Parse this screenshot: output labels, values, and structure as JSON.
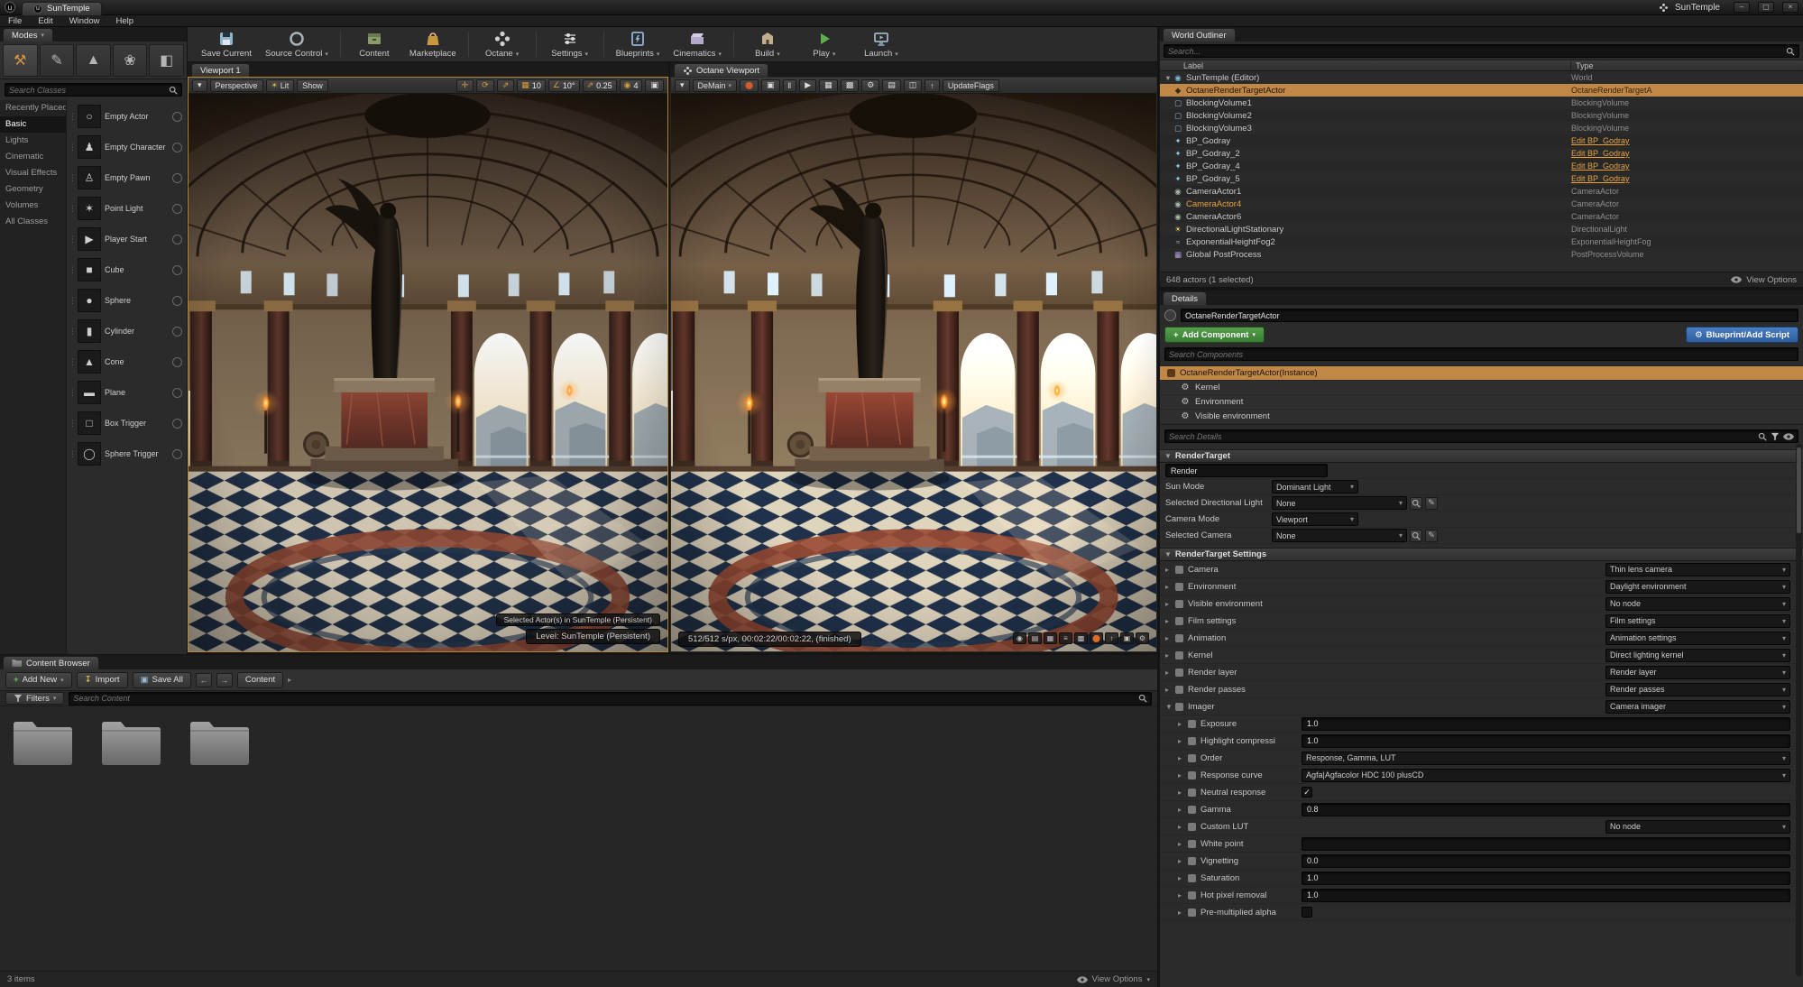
{
  "colors": {
    "selection_tan": "#c08747",
    "accent_orange": "#e8a33d",
    "snap_orange": "#d89a3a",
    "play_green": "#5fae4f",
    "add_component_green": "#4a9342",
    "blueprint_blue": "#3a6cb0",
    "active_viewport_border": "#b5882d"
  },
  "glyphs": {
    "dropdown": "▾",
    "expand_open": "▼",
    "expand_closed": "▸",
    "breadcrumb_sep": "▸",
    "back": "←",
    "forward": "→",
    "close": "×",
    "minimize": "–",
    "restore": "▢",
    "check": "✓",
    "plus": "+",
    "grip": "⋮",
    "sun": "☀",
    "pause": "‖",
    "play": "▶",
    "record": "⬤",
    "camera": "◉",
    "grid": "▦",
    "angle": "∠",
    "scale": "⇗",
    "move": "✛",
    "rotate": "⟳",
    "maximize": "▣",
    "gear": "⚙",
    "pencil": "✎",
    "question": "?",
    "u_logo": "u"
  },
  "titlebar": {
    "doc_tab": "SunTemple",
    "project_title": "SunTemple"
  },
  "menubar": {
    "items": [
      "File",
      "Edit",
      "Window",
      "Help"
    ]
  },
  "modes": {
    "tab": "Modes",
    "search_placeholder": "Search Classes",
    "tools": [
      {
        "name": "place",
        "glyph": "⚒"
      },
      {
        "name": "paint",
        "glyph": "✎"
      },
      {
        "name": "landscape",
        "glyph": "▲"
      },
      {
        "name": "foliage",
        "glyph": "❀"
      },
      {
        "name": "geometry",
        "glyph": "◧"
      }
    ],
    "categories": [
      "Recently Placed",
      "Basic",
      "Lights",
      "Cinematic",
      "Visual Effects",
      "Geometry",
      "Volumes",
      "All Classes"
    ],
    "active_category": "Basic",
    "items": [
      {
        "label": "Empty Actor",
        "glyph": "○"
      },
      {
        "label": "Empty Character",
        "glyph": "♟"
      },
      {
        "label": "Empty Pawn",
        "glyph": "♙"
      },
      {
        "label": "Point Light",
        "glyph": "✶"
      },
      {
        "label": "Player Start",
        "glyph": "▶"
      },
      {
        "label": "Cube",
        "glyph": "■"
      },
      {
        "label": "Sphere",
        "glyph": "●"
      },
      {
        "label": "Cylinder",
        "glyph": "▮"
      },
      {
        "label": "Cone",
        "glyph": "▲"
      },
      {
        "label": "Plane",
        "glyph": "▬"
      },
      {
        "label": "Box Trigger",
        "glyph": "□"
      },
      {
        "label": "Sphere Trigger",
        "glyph": "◯"
      }
    ]
  },
  "main_toolbar": {
    "buttons": [
      {
        "label": "Save Current",
        "dropdown": false
      },
      {
        "label": "Source Control",
        "dropdown": true
      },
      {
        "label": "Content",
        "dropdown": false
      },
      {
        "label": "Marketplace",
        "dropdown": false
      },
      {
        "label": "Octane",
        "dropdown": true
      },
      {
        "label": "Settings",
        "dropdown": true
      },
      {
        "label": "Blueprints",
        "dropdown": true
      },
      {
        "label": "Cinematics",
        "dropdown": true
      },
      {
        "label": "Build",
        "dropdown": true
      },
      {
        "label": "Play",
        "dropdown": true
      },
      {
        "label": "Launch",
        "dropdown": true
      }
    ]
  },
  "viewport1": {
    "tab": "Viewport 1",
    "perspective": "Perspective",
    "lit": "Lit",
    "show": "Show",
    "grid_snap": "10",
    "angle_snap": "10°",
    "scale_snap": "0.25",
    "camera_speed": "4",
    "status_selected": "Selected Actor(s) in SunTemple (Persistent)",
    "status_level": "Level: SunTemple (Persistent)"
  },
  "octane_viewport": {
    "tab": "Octane Viewport",
    "demain": "DeMain",
    "update_flags": "UpdateFlags",
    "render_status": "512/512 s/px, 00:02:22/00:02:22, (finished)",
    "toolbar_icons": [
      "▣",
      "‖",
      "▶",
      "▦",
      "▩",
      "⚙",
      "▤",
      "◫",
      "↑"
    ],
    "bottom_icons": [
      "◉",
      "▤",
      "▦",
      "≡",
      "▩",
      "⬤",
      "↑",
      "▣",
      "⚙"
    ]
  },
  "world_outliner": {
    "tab": "World Outliner",
    "search_placeholder": "Search...",
    "col_label": "Label",
    "col_type": "Type",
    "rows": [
      {
        "label": "SunTemple (Editor)",
        "type": "World",
        "icon": "◉"
      },
      {
        "label": "OctaneRenderTargetActor",
        "type": "OctaneRenderTargetA",
        "icon": "◆",
        "selected": true
      },
      {
        "label": "BlockingVolume1",
        "type": "BlockingVolume",
        "icon": "▢"
      },
      {
        "label": "BlockingVolume2",
        "type": "BlockingVolume",
        "icon": "▢"
      },
      {
        "label": "BlockingVolume3",
        "type": "BlockingVolume",
        "icon": "▢"
      },
      {
        "label": "BP_Godray",
        "type": "Edit BP_Godray",
        "icon": "✦",
        "link": true
      },
      {
        "label": "BP_Godray_2",
        "type": "Edit BP_Godray",
        "icon": "✦",
        "link": true
      },
      {
        "label": "BP_Godray_4",
        "type": "Edit BP_Godray",
        "icon": "✦",
        "link": true
      },
      {
        "label": "BP_Godray_5",
        "type": "Edit BP_Godray",
        "icon": "✦",
        "link": true
      },
      {
        "label": "CameraActor1",
        "type": "CameraActor",
        "icon": "◉"
      },
      {
        "label": "CameraActor4",
        "type": "CameraActor",
        "icon": "◉",
        "highlight": true
      },
      {
        "label": "CameraActor6",
        "type": "CameraActor",
        "icon": "◉"
      },
      {
        "label": "DirectionalLightStationary",
        "type": "DirectionalLight",
        "icon": "☀"
      },
      {
        "label": "ExponentialHeightFog2",
        "type": "ExponentialHeightFog",
        "icon": "≈"
      },
      {
        "label": "Global PostProcess",
        "type": "PostProcessVolume",
        "icon": "▦"
      }
    ],
    "footer": "648 actors (1 selected)",
    "view_options": "View Options"
  },
  "details": {
    "tab": "Details",
    "actor_name": "OctaneRenderTargetActor",
    "add_component": "Add Component",
    "blueprint_add_script": "Blueprint/Add Script",
    "search_components_placeholder": "Search Components",
    "components": [
      {
        "label": "OctaneRenderTargetActor(Instance)",
        "selected": true
      },
      {
        "label": "Kernel"
      },
      {
        "label": "Environment"
      },
      {
        "label": "Visible environment"
      }
    ],
    "search_details_placeholder": "Search Details",
    "render_target": {
      "header": "RenderTarget",
      "render_field": "Render",
      "rows": [
        {
          "label": "Sun Mode",
          "value": "Dominant Light"
        },
        {
          "label": "Selected Directional Light",
          "value": "None"
        },
        {
          "label": "Camera Mode",
          "value": "Viewport"
        },
        {
          "label": "Selected Camera",
          "value": "None"
        }
      ]
    },
    "settings": {
      "header": "RenderTarget Settings",
      "rows": [
        {
          "label": "Camera",
          "value": "Thin lens camera",
          "kind": "node"
        },
        {
          "label": "Environment",
          "value": "Daylight environment",
          "kind": "node"
        },
        {
          "label": "Visible environment",
          "value": "No node",
          "kind": "node"
        },
        {
          "label": "Film settings",
          "value": "Film settings",
          "kind": "node"
        },
        {
          "label": "Animation",
          "value": "Animation settings",
          "kind": "node"
        },
        {
          "label": "Kernel",
          "value": "Direct lighting kernel",
          "kind": "node"
        },
        {
          "label": "Render layer",
          "value": "Render layer",
          "kind": "node"
        },
        {
          "label": "Render passes",
          "value": "Render passes",
          "kind": "node"
        },
        {
          "label": "Imager",
          "value": "Camera imager",
          "kind": "node"
        },
        {
          "label": "Exposure",
          "value": "1.0",
          "kind": "number"
        },
        {
          "label": "Highlight compressi",
          "value": "1.0",
          "kind": "number"
        },
        {
          "label": "Order",
          "value": "Response, Gamma, LUT",
          "kind": "text"
        },
        {
          "label": "Response curve",
          "value": "Agfa|Agfacolor HDC 100 plusCD",
          "kind": "text"
        },
        {
          "label": "Neutral response",
          "value": "checked",
          "kind": "check"
        },
        {
          "label": "Gamma",
          "value": "0.8",
          "kind": "number"
        },
        {
          "label": "Custom LUT",
          "value": "No node",
          "kind": "node"
        },
        {
          "label": "White point",
          "value": "",
          "kind": "number"
        },
        {
          "label": "Vignetting",
          "value": "0.0",
          "kind": "number"
        },
        {
          "label": "Saturation",
          "value": "1.0",
          "kind": "number"
        },
        {
          "label": "Hot pixel removal",
          "value": "1.0",
          "kind": "number"
        },
        {
          "label": "Pre-multiplied alpha",
          "value": "unchecked",
          "kind": "check"
        }
      ]
    }
  },
  "content_browser": {
    "tab": "Content Browser",
    "add_new": "Add New",
    "import": "Import",
    "save_all": "Save All",
    "breadcrumb": "Content",
    "filters": "Filters",
    "search_placeholder": "Search Content",
    "folder_count": 3,
    "items_count": "3 items",
    "view_options": "View Options"
  }
}
